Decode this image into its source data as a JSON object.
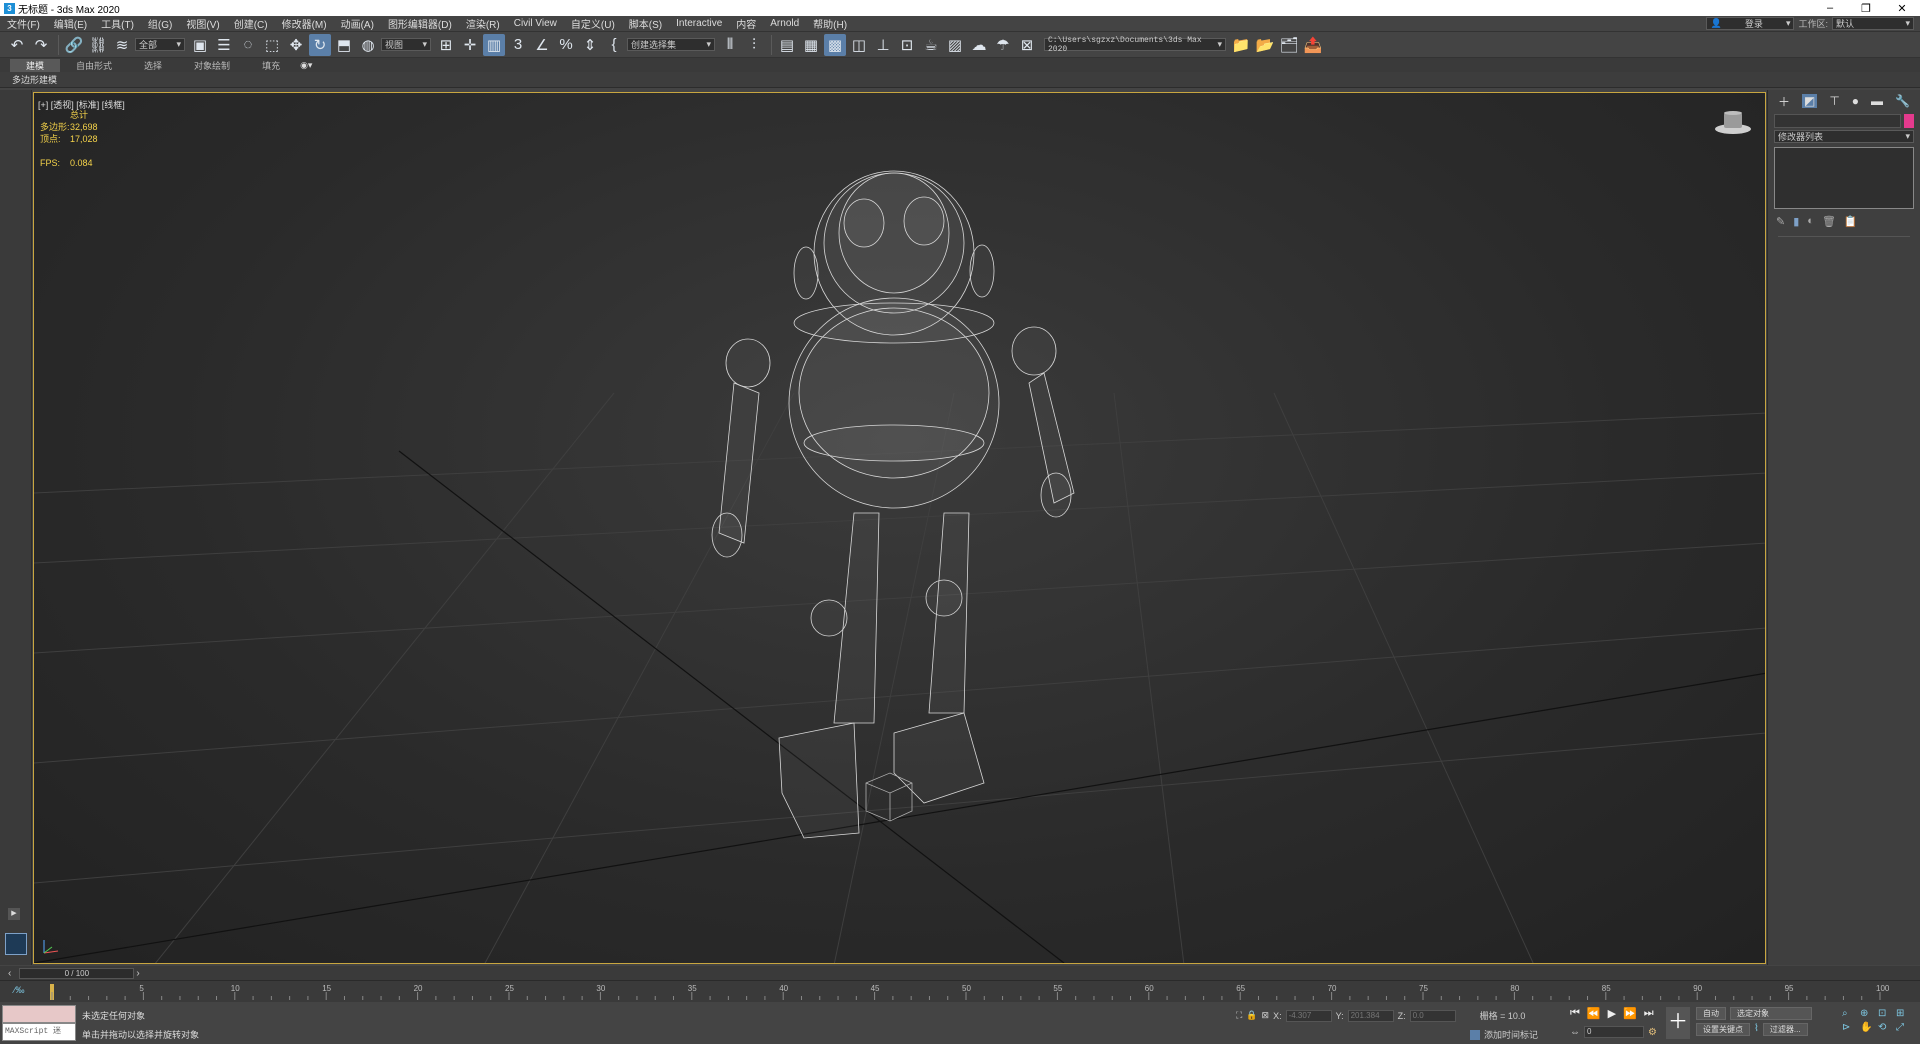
{
  "window": {
    "title": "无标题 - 3ds Max 2020",
    "minimize": "–",
    "restore": "❐",
    "close": "✕"
  },
  "menu": {
    "items": [
      "文件(F)",
      "编辑(E)",
      "工具(T)",
      "组(G)",
      "视图(V)",
      "创建(C)",
      "修改器(M)",
      "动画(A)",
      "图形编辑器(D)",
      "渲染(R)",
      "Civil View",
      "自定义(U)",
      "脚本(S)",
      "Interactive",
      "内容",
      "Arnold",
      "帮助(H)"
    ],
    "signin": "登录",
    "workspace_label": "工作区:",
    "workspace_value": "默认"
  },
  "toolbar": {
    "selection_filter": "全部",
    "ref_coord": "视图",
    "named_selection": "创建选择集",
    "project_path": "C:\\Users\\sgzxz\\Documents\\3ds Max 2020"
  },
  "ribbon": {
    "tabs": [
      "建模",
      "自由形式",
      "选择",
      "对象绘制",
      "填充"
    ],
    "active_tab": "建模",
    "subtitle": "多边形建模"
  },
  "viewport": {
    "label": "[+] [透视] [标准] [线框]",
    "stats": {
      "total_label": "总计",
      "poly_label": "多边形:",
      "poly_value": "32,698",
      "vert_label": "顶点:",
      "vert_value": "17,028",
      "fps_label": "FPS:",
      "fps_value": "0.084"
    }
  },
  "command_panel": {
    "modifier_list": "修改器列表"
  },
  "time": {
    "frame_display": "0 / 100",
    "ticks": [
      "0",
      "5",
      "10",
      "15",
      "20",
      "25",
      "30",
      "35",
      "40",
      "45",
      "50",
      "55",
      "60",
      "65",
      "70",
      "75",
      "80",
      "85",
      "90",
      "95",
      "100"
    ]
  },
  "status": {
    "maxscript_label": "MAXScript 迷",
    "msg1": "未选定任何对象",
    "msg2": "单击并拖动以选择并旋转对象",
    "x_label": "X:",
    "x_value": "-4.307",
    "y_label": "Y:",
    "y_value": "201.384",
    "z_label": "Z:",
    "z_value": "0.0",
    "grid": "栅格 = 10.0",
    "add_time_tag": "添加时间标记",
    "auto_key": "自动",
    "selected_obj": "选定对象",
    "set_key": "设置关键点",
    "filters": "过滤器...",
    "current_frame": "0"
  },
  "colors": {
    "viewport_border": "#c8a640",
    "stats_text": "#f5d34a",
    "active_tool": "#5b7fa8",
    "swatch": "#e43a8d"
  }
}
